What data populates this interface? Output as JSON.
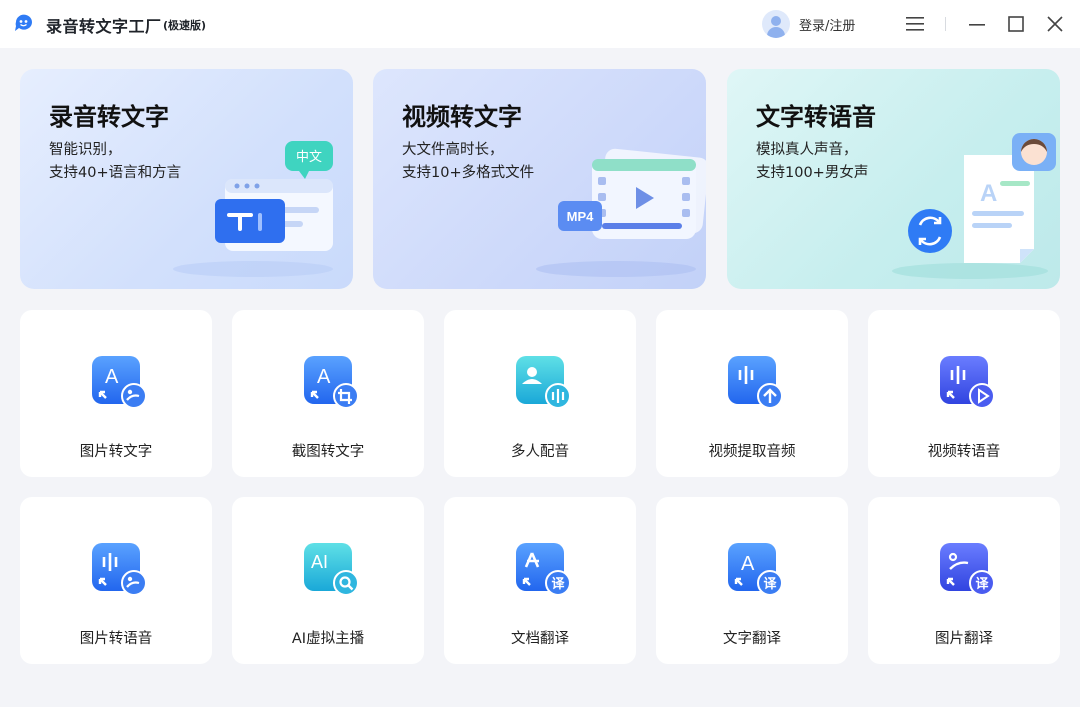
{
  "app": {
    "title": "录音转文字工厂",
    "edition": "(极速版)",
    "login_label": "登录/注册",
    "accent": "#2f7bf5"
  },
  "features": [
    {
      "title": "录音转文字",
      "desc1": "智能识别，",
      "desc2": "支持40+语言和方言",
      "art_badge": "中文"
    },
    {
      "title": "视频转文字",
      "desc1": "大文件高时长，",
      "desc2": "支持10+多格式文件",
      "art_badge": "MP4"
    },
    {
      "title": "文字转语音",
      "desc1": "模拟真人声音，",
      "desc2": "支持100+男女声",
      "art_badge": "A"
    }
  ],
  "tools": [
    {
      "label": "图片转文字",
      "icon": "image-to-text-icon"
    },
    {
      "label": "截图转文字",
      "icon": "screenshot-to-text-icon"
    },
    {
      "label": "多人配音",
      "icon": "multi-voice-dubbing-icon"
    },
    {
      "label": "视频提取音频",
      "icon": "extract-audio-icon"
    },
    {
      "label": "视频转语音",
      "icon": "video-to-speech-icon"
    },
    {
      "label": "图片转语音",
      "icon": "image-to-speech-icon"
    },
    {
      "label": "AI虚拟主播",
      "icon": "ai-anchor-icon"
    },
    {
      "label": "文档翻译",
      "icon": "document-translate-icon"
    },
    {
      "label": "文字翻译",
      "icon": "text-translate-icon"
    },
    {
      "label": "图片翻译",
      "icon": "image-translate-icon"
    }
  ],
  "icon_glyphs": {
    "a_letter": "A",
    "ai_letters": "AI",
    "translate_char": "译"
  }
}
